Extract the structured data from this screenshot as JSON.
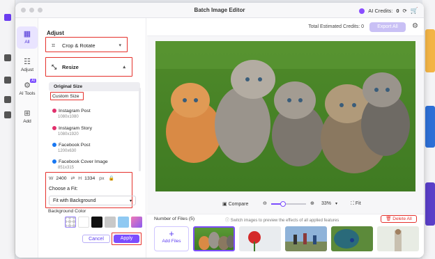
{
  "window": {
    "title": "Batch Image Editor"
  },
  "credits": {
    "label": "AI Credits:",
    "value": "0"
  },
  "tools": [
    {
      "label": "All",
      "icon": "grid-icon"
    },
    {
      "label": "Adjust",
      "icon": "sliders-icon"
    },
    {
      "label": "AI Tools",
      "icon": "ai-icon",
      "badge": "AI"
    },
    {
      "label": "Add",
      "icon": "plus-icon"
    }
  ],
  "panel": {
    "title": "Adjust",
    "crop_label": "Crop & Rotate",
    "resize_label": "Resize",
    "sizes": [
      {
        "label": "Original Size",
        "sub": ""
      },
      {
        "label": "Custom Size",
        "sub": ""
      },
      {
        "label": "Instagram Post",
        "sub": "1080x1080"
      },
      {
        "label": "Instagram Story",
        "sub": "1080x1920"
      },
      {
        "label": "Facebook Post",
        "sub": "1200x630"
      },
      {
        "label": "Facebook Cover Image",
        "sub": "851x315"
      }
    ],
    "width_label": "W",
    "width_value": "2400",
    "height_label": "H",
    "height_value": "1334",
    "unit": "px",
    "fit_label": "Choose a Fit:",
    "fit_value": "Fit with Background",
    "bg_color_label": "Background Color",
    "cancel_label": "Cancel",
    "apply_label": "Apply"
  },
  "colors": {
    "accent": "#7b4dff",
    "highlight": "#e5302b",
    "swatches": [
      "#ffffff",
      "#111111",
      "#c8c8c8",
      "#8fc9f2",
      "#c46ad8"
    ]
  },
  "header": {
    "estimated_label": "Total Estimated Credits:",
    "estimated_value": "0",
    "export_label": "Export All"
  },
  "zoom": {
    "compare_label": "Compare",
    "level": "33%",
    "fit_label": "Fit",
    "slider_fraction": 0.33
  },
  "files": {
    "count_label": "Number of Files (5)",
    "hint": "Switch images to preview the effects of all applied features",
    "delete_label": "Delete All",
    "add_label": "Add Files"
  }
}
